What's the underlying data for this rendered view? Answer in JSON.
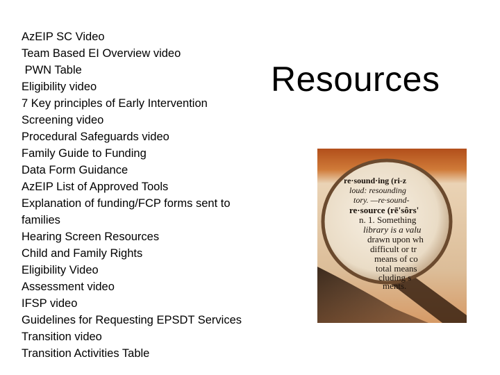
{
  "slide": {
    "title": "Resources",
    "resources": [
      "AzEIP SC Video",
      "Team Based EI Overview video",
      " PWN Table",
      "Eligibility video",
      "7 Key principles of Early Intervention",
      "Screening video",
      "Procedural Safeguards video",
      "Family Guide to Funding",
      "Data Form Guidance",
      "AzEIP List of Approved Tools",
      "Explanation of funding/FCP forms sent to families",
      "Hearing Screen Resources",
      "Child and Family Rights",
      "Eligibility Video",
      "Assessment video",
      "IFSP video",
      "Guidelines for Requesting EPSDT Services",
      "Transition video",
      "Transition Activities Table"
    ],
    "image": {
      "description": "magnifying-glass-over-dictionary",
      "lens_text": [
        "re·sound·ing (ri-z",
        "loud: resounding",
        "tory. —re·sound-",
        "re·source (rē'sôrs'",
        "n. 1. Something",
        "library is a valu",
        "drawn upon wh",
        "difficult or tr",
        "means of co",
        "total means",
        "cluding s",
        "ments."
      ]
    }
  }
}
